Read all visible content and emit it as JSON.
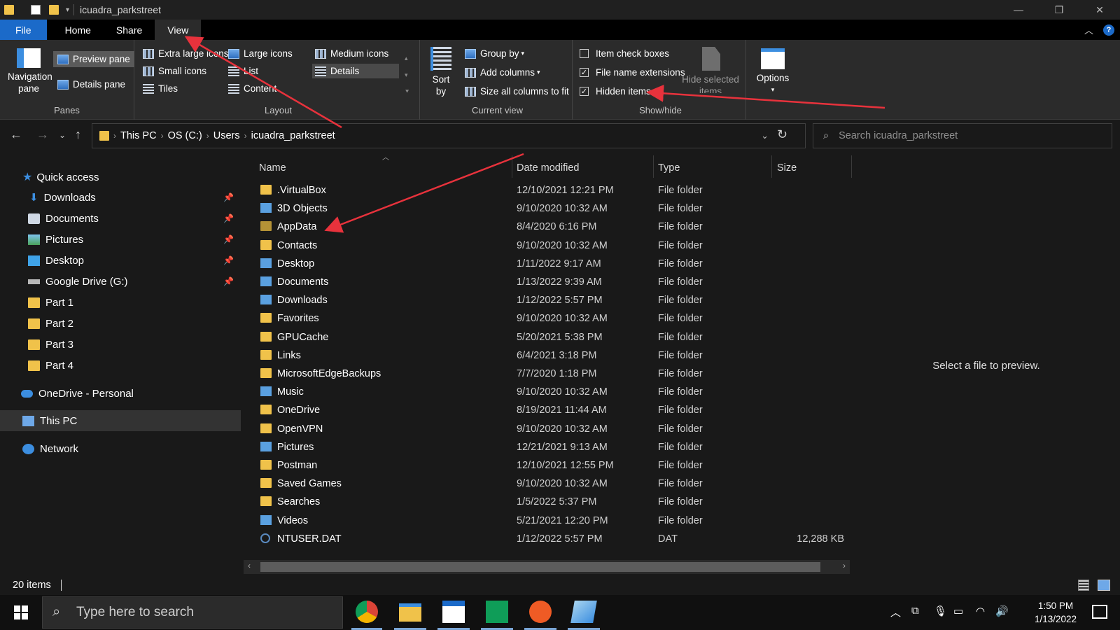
{
  "window": {
    "title": "icuadra_parkstreet"
  },
  "tabs": [
    "File",
    "Home",
    "Share",
    "View"
  ],
  "ribbon": {
    "panes": {
      "label": "Panes",
      "navigation_pane": "Navigation pane",
      "preview_pane": "Preview pane",
      "details_pane": "Details pane"
    },
    "layout": {
      "label": "Layout",
      "extra_large": "Extra large icons",
      "large": "Large icons",
      "medium": "Medium icons",
      "small": "Small icons",
      "list": "List",
      "details": "Details",
      "tiles": "Tiles",
      "content": "Content"
    },
    "current_view": {
      "label": "Current view",
      "sort_by": "Sort by",
      "group_by": "Group by",
      "add_columns": "Add columns",
      "size_all_columns": "Size all columns to fit"
    },
    "show_hide": {
      "label": "Show/hide",
      "item_check_boxes": "Item check boxes",
      "file_name_extensions": "File name extensions",
      "hidden_items": "Hidden items",
      "hide_selected": "Hide selected items",
      "item_check_boxes_checked": false,
      "file_name_extensions_checked": true,
      "hidden_items_checked": true
    },
    "options": "Options"
  },
  "address": {
    "crumbs": [
      "This PC",
      "OS (C:)",
      "Users",
      "icuadra_parkstreet"
    ],
    "search_placeholder": "Search icuadra_parkstreet"
  },
  "nav": {
    "quick_access": "Quick access",
    "items": [
      {
        "label": "Downloads",
        "pinned": true
      },
      {
        "label": "Documents",
        "pinned": true
      },
      {
        "label": "Pictures",
        "pinned": true
      },
      {
        "label": "Desktop",
        "pinned": true
      },
      {
        "label": "Google Drive (G:)",
        "pinned": true
      },
      {
        "label": "Part 1",
        "pinned": false
      },
      {
        "label": "Part 2",
        "pinned": false
      },
      {
        "label": "Part 3",
        "pinned": false
      },
      {
        "label": "Part 4",
        "pinned": false
      }
    ],
    "onedrive": "OneDrive - Personal",
    "this_pc": "This PC",
    "network": "Network"
  },
  "columns": {
    "name": "Name",
    "date": "Date modified",
    "type": "Type",
    "size": "Size"
  },
  "files": [
    {
      "name": ".VirtualBox",
      "date": "12/10/2021 12:21 PM",
      "type": "File folder",
      "size": ""
    },
    {
      "name": "3D Objects",
      "date": "9/10/2020 10:32 AM",
      "type": "File folder",
      "size": ""
    },
    {
      "name": "AppData",
      "date": "8/4/2020 6:16 PM",
      "type": "File folder",
      "size": ""
    },
    {
      "name": "Contacts",
      "date": "9/10/2020 10:32 AM",
      "type": "File folder",
      "size": ""
    },
    {
      "name": "Desktop",
      "date": "1/11/2022 9:17 AM",
      "type": "File folder",
      "size": ""
    },
    {
      "name": "Documents",
      "date": "1/13/2022 9:39 AM",
      "type": "File folder",
      "size": ""
    },
    {
      "name": "Downloads",
      "date": "1/12/2022 5:57 PM",
      "type": "File folder",
      "size": ""
    },
    {
      "name": "Favorites",
      "date": "9/10/2020 10:32 AM",
      "type": "File folder",
      "size": ""
    },
    {
      "name": "GPUCache",
      "date": "5/20/2021 5:38 PM",
      "type": "File folder",
      "size": ""
    },
    {
      "name": "Links",
      "date": "6/4/2021 3:18 PM",
      "type": "File folder",
      "size": ""
    },
    {
      "name": "MicrosoftEdgeBackups",
      "date": "7/7/2020 1:18 PM",
      "type": "File folder",
      "size": ""
    },
    {
      "name": "Music",
      "date": "9/10/2020 10:32 AM",
      "type": "File folder",
      "size": ""
    },
    {
      "name": "OneDrive",
      "date": "8/19/2021 11:44 AM",
      "type": "File folder",
      "size": ""
    },
    {
      "name": "OpenVPN",
      "date": "9/10/2020 10:32 AM",
      "type": "File folder",
      "size": ""
    },
    {
      "name": "Pictures",
      "date": "12/21/2021 9:13 AM",
      "type": "File folder",
      "size": ""
    },
    {
      "name": "Postman",
      "date": "12/10/2021 12:55 PM",
      "type": "File folder",
      "size": ""
    },
    {
      "name": "Saved Games",
      "date": "9/10/2020 10:32 AM",
      "type": "File folder",
      "size": ""
    },
    {
      "name": "Searches",
      "date": "1/5/2022 5:37 PM",
      "type": "File folder",
      "size": ""
    },
    {
      "name": "Videos",
      "date": "5/21/2021 12:20 PM",
      "type": "File folder",
      "size": ""
    },
    {
      "name": "NTUSER.DAT",
      "date": "1/12/2022 5:57 PM",
      "type": "DAT",
      "size": "12,288 KB"
    }
  ],
  "preview_text": "Select a file to preview.",
  "status": {
    "count": "20 items"
  },
  "taskbar": {
    "search_placeholder": "Type here to search",
    "time": "1:50 PM",
    "date": "1/13/2022"
  },
  "colors": {
    "accent": "#1b6ac9",
    "annotation_arrow": "#e8323c",
    "folder": "#f0c24a"
  }
}
